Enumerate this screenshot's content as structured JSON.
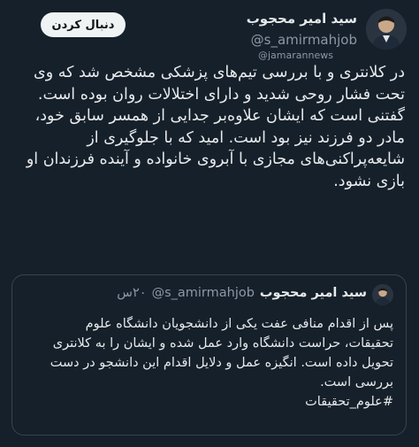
{
  "tweet": {
    "follow_label": "دنبال کردن",
    "author_name": "سید امیر محجوب",
    "author_handle": "@s_amirmahjob",
    "watermark": "@jamarannews",
    "body_lines": [
      "در کلانتری و با بررسی تیم‌های پزشکی مشخص شد که وی تحت فشار روحی شدید و دارای اختلالات روان بوده است.",
      "گفتنی است که ایشان علاوه‌بر جدایی از همسر سابق خود، مادر دو فرزند نیز بود است. امید که با جلوگیری از شایعه‌پراکنی‌های مجازی با آبروی خانواده و آینده فرزندان او بازی نشود."
    ]
  },
  "quoted": {
    "author_name": "سید امیر محجوب",
    "author_handle": "@s_amirmahjob",
    "time": "۲۰س",
    "text": "پس از اقدام منافی عفت یکی از دانشجویان دانشگاه علوم تحقیقات، حراست دانشگاه وارد عمل شده و ایشان را به کلانتری تحویل داده است. انگیزه عمل و دلایل اقدام این دانشجو در دست بررسی است.",
    "hashtag": "#علوم_تحقیقات"
  },
  "colors": {
    "background": "#15202b",
    "text": "#e7e9ea",
    "muted": "#8b98a5",
    "border": "#38444d",
    "button_bg": "#eff3f4"
  },
  "icons": [
    "avatar",
    "verified-icon"
  ]
}
